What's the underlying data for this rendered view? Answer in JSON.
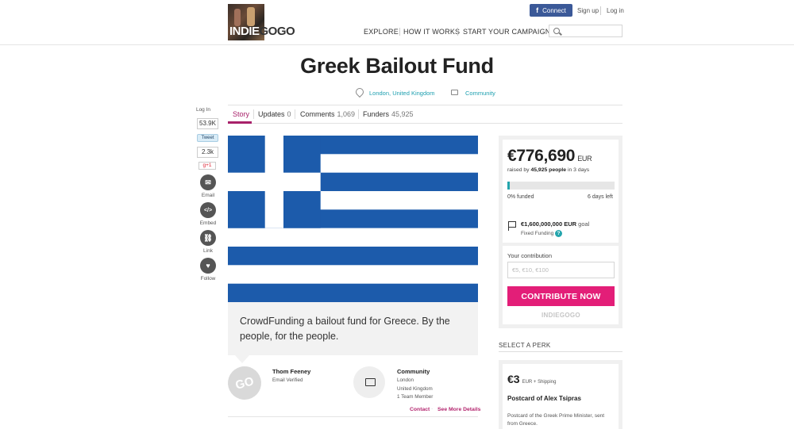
{
  "header": {
    "logo_text_1": "INDIE",
    "logo_text_2": "GOGO",
    "fb_connect": "Connect",
    "signup": "Sign up",
    "login": "Log in",
    "nav": [
      "EXPLORE",
      "HOW IT WORKS",
      "START YOUR CAMPAIGN"
    ],
    "search_placeholder": ""
  },
  "campaign": {
    "title": "Greek Bailout Fund",
    "location": "London, United Kingdom",
    "category": "Community"
  },
  "tabs": [
    {
      "label": "Story",
      "count": ""
    },
    {
      "label": "Updates",
      "count": "0"
    },
    {
      "label": "Comments",
      "count": "1,069"
    },
    {
      "label": "Funders",
      "count": "45,925"
    }
  ],
  "social": {
    "login": "Log In",
    "fb_count": "53.9K",
    "tweet": "Tweet",
    "tweet_count": "2.3k",
    "gplus": "g+1",
    "email": "Email",
    "embed": "Embed",
    "link": "Link",
    "follow": "Follow"
  },
  "description": "CrowdFunding a bailout fund for Greece. By the people, for the people.",
  "owner": {
    "avatar_text": "GO",
    "name": "Thom Feeney",
    "verified": "Email Verified",
    "community_title": "Community",
    "community_city": "London",
    "community_country": "United Kingdom",
    "team": "1 Team Member",
    "contact": "Contact",
    "see_more": "See More Details"
  },
  "funding": {
    "amount": "€776,690",
    "currency": "EUR",
    "raised_prefix": "raised by",
    "people": "45,925 people",
    "raised_suffix": "in 3 days",
    "percent_funded": "0% funded",
    "days_left": "6 days left",
    "progress_fraction": 0.02,
    "goal_amount": "€1,600,000,000 EUR",
    "goal_word": "goal",
    "funding_type": "Fixed Funding",
    "help": "?",
    "contribution_label": "Your contribution",
    "contribution_placeholder": "€5, €10, €100",
    "contribute_button": "CONTRIBUTE NOW",
    "powered_by": "INDIEGOGO"
  },
  "perks": {
    "heading": "SELECT A PERK",
    "items": [
      {
        "price": "€3",
        "shipping": "EUR + Shipping",
        "title": "Postcard of Alex Tsipras",
        "description": "Postcard of the Greek Prime Minister, sent from Greece."
      }
    ]
  },
  "colors": {
    "accent_pink": "#e31e78",
    "tab_active": "#a8216a",
    "teal": "#24a5ad",
    "greek_blue": "#1c5bab"
  }
}
